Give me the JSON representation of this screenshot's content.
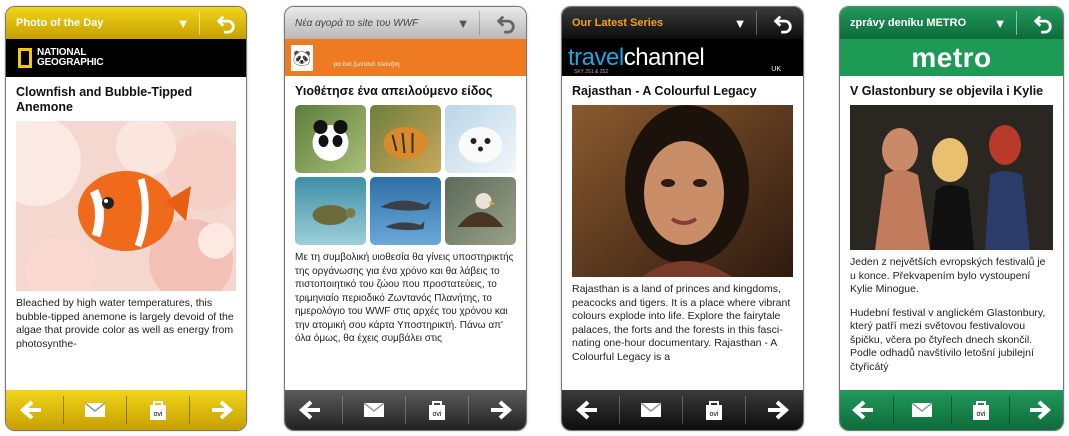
{
  "screens": [
    {
      "header": {
        "title": "Photo of the Day"
      },
      "brand": {
        "line1": "NATIONAL",
        "line2": "GEOGRAPHIC"
      },
      "headline": "Clownfish and Bubble-Tipped Anemone",
      "body": "Bleached by high water temperatures, this bubble-tipped anemone is largely devoid of the algae that provide color as well as energy from photosynthe-",
      "colors": {
        "accent": "#f1d51a"
      }
    },
    {
      "header": {
        "title": "Νέα αγορά το site του WWF"
      },
      "brand": {
        "tagline": "για ένα ζωντανό πλανήτη"
      },
      "headline": "Υιοθέτησε ένα απειλούμενο είδος",
      "body": "Με τη συμβολική υιοθεσία θα γίνεις υποστηρικτής της οργάνωσης για ένα χρόνο και θα λάβεις το πιστοποιητικό του ζώου που προστατεύεις, το τριμηνιαίο περιοδικό Ζωντανός Πλανήτης, το ημερολόγιο του WWF στις αρχές του χρόνου και την ατομική σου κάρτα Υποστηρικτή. Πάνω απ' όλα όμως, θα έχεις συμβάλει στις",
      "colors": {
        "accent": "#ee7b22"
      }
    },
    {
      "header": {
        "title": "Our Latest Series"
      },
      "brand": {
        "part1": "travel",
        "part2": "channel",
        "region": "UK",
        "sky": "SKY 251 & 252"
      },
      "headline": "Rajasthan - A Colourful Legacy",
      "body": "Rajasthan is a land of princes and kingdoms, peacocks and tigers. It is a place where vibrant colours explode into life. Explore the fairytale palaces, the forts and the forests in this fasci-nating one-hour documentary. Rajasthan - A Colourful Legacy is a",
      "colors": {
        "accent": "#f3a31a"
      }
    },
    {
      "header": {
        "title": "zprávy deníku METRO"
      },
      "brand": {
        "name": "metro"
      },
      "headline": "V Glastonbury se objevila i Kylie",
      "body": "Jeden z největších evropských festivalů je u konce. Překvapením bylo vystoupení Kylie Minogue.",
      "body2": "Hudební festival v anglickém Glastonbury, který patří mezi světovou festivalovou špičku, včera po čtyřech dnech skončil. Podle odhadů navštívilo letošní jubilejní čtyřicátý",
      "colors": {
        "accent": "#1c9a56"
      }
    }
  ],
  "nav": {
    "icons": [
      "left-arrow-icon",
      "mail-icon",
      "ovi-store-icon",
      "right-arrow-icon"
    ],
    "ovi_label": "ovi"
  }
}
